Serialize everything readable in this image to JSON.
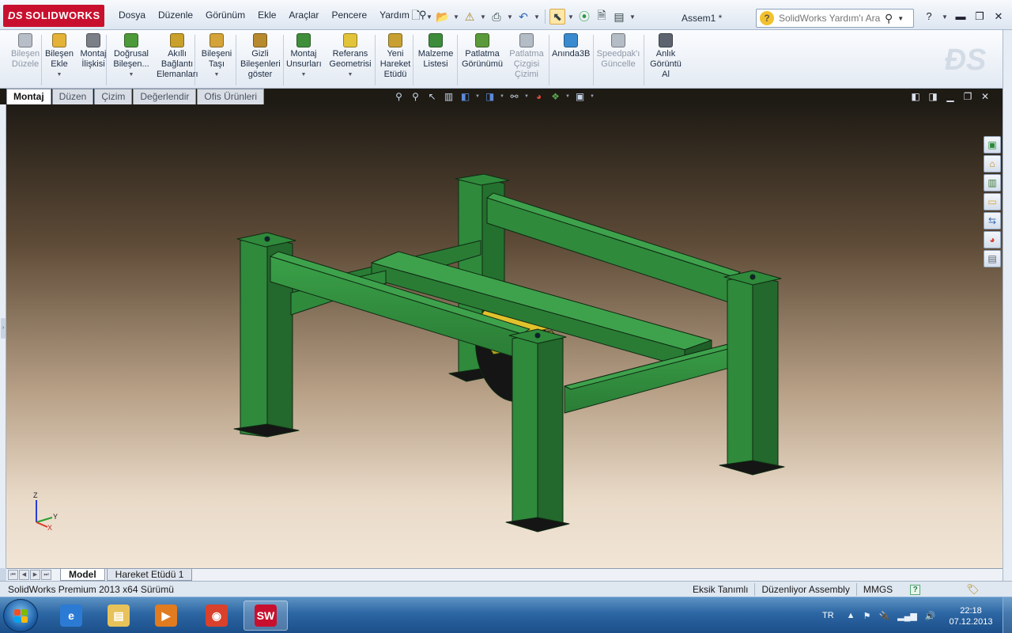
{
  "app": {
    "logo_text": "SOLIDWORKS",
    "logo_prefix": "DS",
    "document_title": "Assem1 *"
  },
  "menu": [
    "Dosya",
    "Düzenle",
    "Görünüm",
    "Ekle",
    "Araçlar",
    "Pencere",
    "Yardım"
  ],
  "quick_toolbar": [
    "new-document",
    "open",
    "save",
    "print",
    "undo",
    "select",
    "rebuild",
    "file-properties",
    "options"
  ],
  "help_search": {
    "placeholder": "SolidWorks Yardım'ı Ara"
  },
  "window_controls": [
    "help",
    "minimize",
    "restore",
    "close"
  ],
  "command_manager": {
    "buttons": [
      {
        "id": "bilesen-duzele",
        "lines": [
          "Bileşen",
          "Düzele"
        ],
        "enabled": false,
        "dropdown": false,
        "icon_color": "#b7bec8"
      },
      {
        "id": "bilesen-ekle",
        "lines": [
          "Bileşen",
          "Ekle"
        ],
        "enabled": true,
        "dropdown": true,
        "icon_color": "#e3b236"
      },
      {
        "id": "montaj-iliskisi",
        "lines": [
          "Montaj",
          "İlişkisi"
        ],
        "enabled": true,
        "dropdown": false,
        "icon_color": "#7a7f88"
      },
      {
        "id": "dogrusal-bilesen",
        "lines": [
          "Doğrusal",
          "Bileşen..."
        ],
        "enabled": true,
        "dropdown": true,
        "icon_color": "#4c9a3a"
      },
      {
        "id": "akilli-baglanti",
        "lines": [
          "Akıllı",
          "Bağlantı",
          "Elemanları"
        ],
        "enabled": true,
        "dropdown": false,
        "icon_color": "#c8a02a"
      },
      {
        "id": "bileseni-tasi",
        "lines": [
          "Bileşeni",
          "Taşı"
        ],
        "enabled": true,
        "dropdown": true,
        "icon_color": "#d4a43a"
      },
      {
        "id": "gizli-bilesenler",
        "lines": [
          "Gizli",
          "Bileşenleri",
          "göster"
        ],
        "enabled": true,
        "dropdown": false,
        "icon_color": "#b88a2e"
      },
      {
        "id": "montaj-unsurlari",
        "lines": [
          "Montaj",
          "Unsurları"
        ],
        "enabled": true,
        "dropdown": true,
        "icon_color": "#3f8f3a"
      },
      {
        "id": "referans-geometrisi",
        "lines": [
          "Referans",
          "Geometrisi"
        ],
        "enabled": true,
        "dropdown": true,
        "icon_color": "#e2c43a"
      },
      {
        "id": "yeni-hareket-etudu",
        "lines": [
          "Yeni",
          "Hareket",
          "Etüdü"
        ],
        "enabled": true,
        "dropdown": false,
        "icon_color": "#c8a032"
      },
      {
        "id": "malzeme-listesi",
        "lines": [
          "Malzeme",
          "Listesi"
        ],
        "enabled": true,
        "dropdown": false,
        "icon_color": "#3c8c3c"
      },
      {
        "id": "patlatma-gorunumu",
        "lines": [
          "Patlatma",
          "Görünümü"
        ],
        "enabled": true,
        "dropdown": false,
        "icon_color": "#5a9a3a"
      },
      {
        "id": "patlatma-cizgisi",
        "lines": [
          "Patlatma",
          "Çizgisi",
          "Çizimi"
        ],
        "enabled": false,
        "dropdown": false,
        "icon_color": "#b4bcc6"
      },
      {
        "id": "aninda-3b",
        "lines": [
          "Anında3B"
        ],
        "enabled": true,
        "dropdown": false,
        "icon_color": "#3a8ad0"
      },
      {
        "id": "speedpak",
        "lines": [
          "Speedpak'ı",
          "Güncelle"
        ],
        "enabled": false,
        "dropdown": false,
        "icon_color": "#b4bcc6"
      },
      {
        "id": "anlik-goruntu",
        "lines": [
          "Anlık",
          "Görüntü",
          "Al"
        ],
        "enabled": true,
        "dropdown": false,
        "icon_color": "#5d6470"
      }
    ]
  },
  "cm_tabs": [
    {
      "label": "Montaj",
      "active": true
    },
    {
      "label": "Düzen",
      "active": false
    },
    {
      "label": "Çizim",
      "active": false
    },
    {
      "label": "Değerlendir",
      "active": false
    },
    {
      "label": "Ofis Ürünleri",
      "active": false
    }
  ],
  "heads_up_toolbar": [
    "zoom-to-fit",
    "zoom-to-area",
    "previous-view",
    "section-view",
    "view-orientation",
    "display-style",
    "hide-show-items",
    "edit-appearance",
    "apply-scene",
    "view-settings"
  ],
  "viewport_controls": [
    "tile-left",
    "tile-right",
    "minimize",
    "restore",
    "close"
  ],
  "task_pane": [
    "solidworks-resources",
    "design-library",
    "file-explorer",
    "view-palette",
    "appearances",
    "custom-properties"
  ],
  "triad": {
    "z": "Z",
    "y": "Y",
    "x": "X"
  },
  "model_tabs": [
    {
      "label": "Model",
      "active": true
    },
    {
      "label": "Hareket Etüdü 1",
      "active": false
    }
  ],
  "status_bar": {
    "version": "SolidWorks Premium 2013 x64 Sürümü",
    "definition": "Eksik Tanımlı",
    "mode": "Düzenliyor Assembly",
    "units": "MMGS",
    "help": "?"
  },
  "taskbar": {
    "apps": [
      {
        "id": "internet-explorer",
        "active": false,
        "color": "#2b7bd4",
        "glyph": "e"
      },
      {
        "id": "file-explorer",
        "active": false,
        "color": "#e7c25a",
        "glyph": "▤"
      },
      {
        "id": "media-player",
        "active": false,
        "color": "#e07b20",
        "glyph": "▶"
      },
      {
        "id": "chrome",
        "active": false,
        "color": "#d9412c",
        "glyph": "◉"
      },
      {
        "id": "solidworks",
        "active": true,
        "color": "#c8102e",
        "glyph": "SW"
      }
    ],
    "language": "TR",
    "time": "22:18",
    "date": "07.12.2013"
  },
  "colors": {
    "frame_green": "#2f8a3c",
    "frame_green_dark": "#1f5f28",
    "frame_green_light": "#3ea24c",
    "blade_yellow": "#e2c22c",
    "accent_red": "#c8102e"
  }
}
